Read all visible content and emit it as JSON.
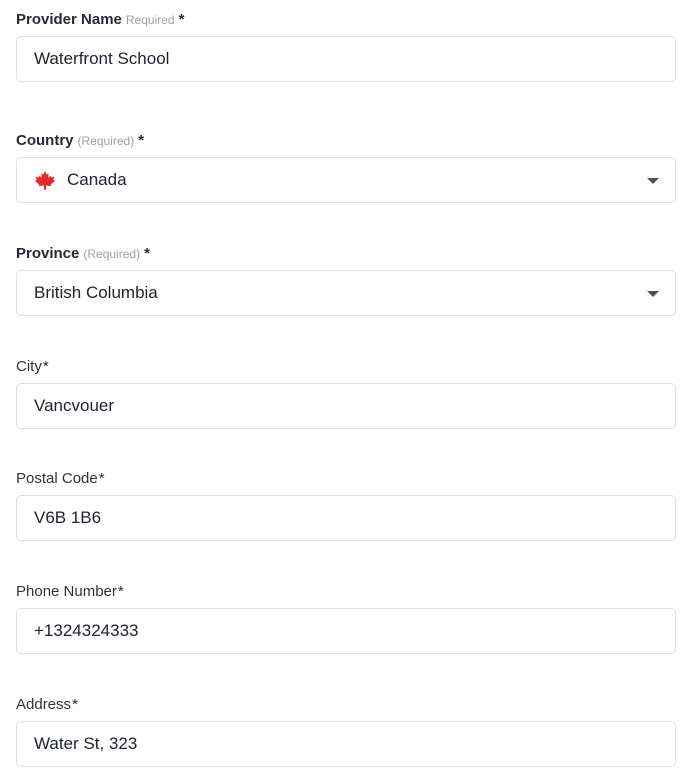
{
  "fields": {
    "provider_name": {
      "label": "Provider Name",
      "required_note": "Required",
      "star": "*",
      "value": "Waterfront School"
    },
    "country": {
      "label": "Country",
      "required_note": "(Required)",
      "star": "*",
      "value": "Canada",
      "flag_icon": "canada-flag-icon"
    },
    "province": {
      "label": "Province",
      "required_note": "(Required)",
      "star": "*",
      "value": "British Columbia"
    },
    "city": {
      "label": "City",
      "star": "*",
      "value": "Vancvouer"
    },
    "postal_code": {
      "label": "Postal Code",
      "star": "*",
      "value": "V6B 1B6"
    },
    "phone_number": {
      "label": "Phone Number",
      "star": "*",
      "value": "+1324324333"
    },
    "address": {
      "label": "Address",
      "star": "*",
      "value": "Water St, 323"
    }
  },
  "colors": {
    "border": "#dcdfe5",
    "label": "#2d3340",
    "required_note": "#9aa1ad",
    "flag_red": "#e0282d"
  }
}
